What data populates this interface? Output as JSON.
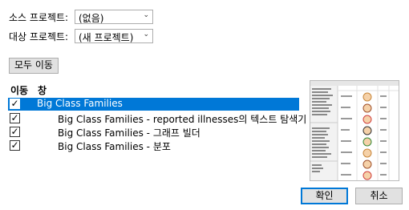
{
  "source_label": "소스 프로젝트:",
  "source_value": "(없음)",
  "target_label": "대상 프로젝트:",
  "target_value": "(새 프로젝트)",
  "move_all_label": "모두 이동",
  "columns": {
    "move": "이동",
    "window": "창"
  },
  "windows": [
    {
      "title": "Big Class Families",
      "checked": true,
      "selected": true
    },
    {
      "title": "Big Class Families - reported illnesses의 텍스트 탐색기",
      "checked": true,
      "selected": false
    },
    {
      "title": "Big Class Families - 그래프 빌더",
      "checked": true,
      "selected": false
    },
    {
      "title": "Big Class Families - 분포",
      "checked": true,
      "selected": false
    }
  ],
  "ok_label": "확인",
  "cancel_label": "취소"
}
